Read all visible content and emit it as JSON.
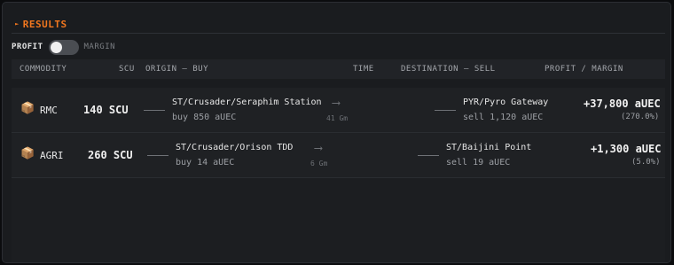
{
  "header": {
    "title": "RESULTS",
    "icon": "caret-right-icon",
    "accent": "#f2771f"
  },
  "toggle": {
    "left_label": "PROFIT",
    "right_label": "MARGIN",
    "state": "profit"
  },
  "table": {
    "columns": [
      "COMMODITY",
      "SCU",
      "ORIGIN — BUY",
      "TIME",
      "DESTINATION — SELL",
      "PROFIT / MARGIN"
    ],
    "rows": [
      {
        "icon": "package-icon",
        "commodity": "RMC",
        "scu": "140 SCU",
        "origin": "ST/Crusader/Seraphim Station",
        "buy": "buy 850 aUEC",
        "distance": "41 Gm",
        "destination": "PYR/Pyro Gateway",
        "sell": "sell 1,120 aUEC",
        "profit": "+37,800 aUEC",
        "margin": "(270.0%)"
      },
      {
        "icon": "package-icon",
        "commodity": "AGRI",
        "scu": "260 SCU",
        "origin": "ST/Crusader/Orison TDD",
        "buy": "buy 14 aUEC",
        "distance": "6 Gm",
        "destination": "ST/Baijini Point",
        "sell": "sell 19 aUEC",
        "profit": "+1,300 aUEC",
        "margin": "(5.0%)"
      }
    ]
  }
}
